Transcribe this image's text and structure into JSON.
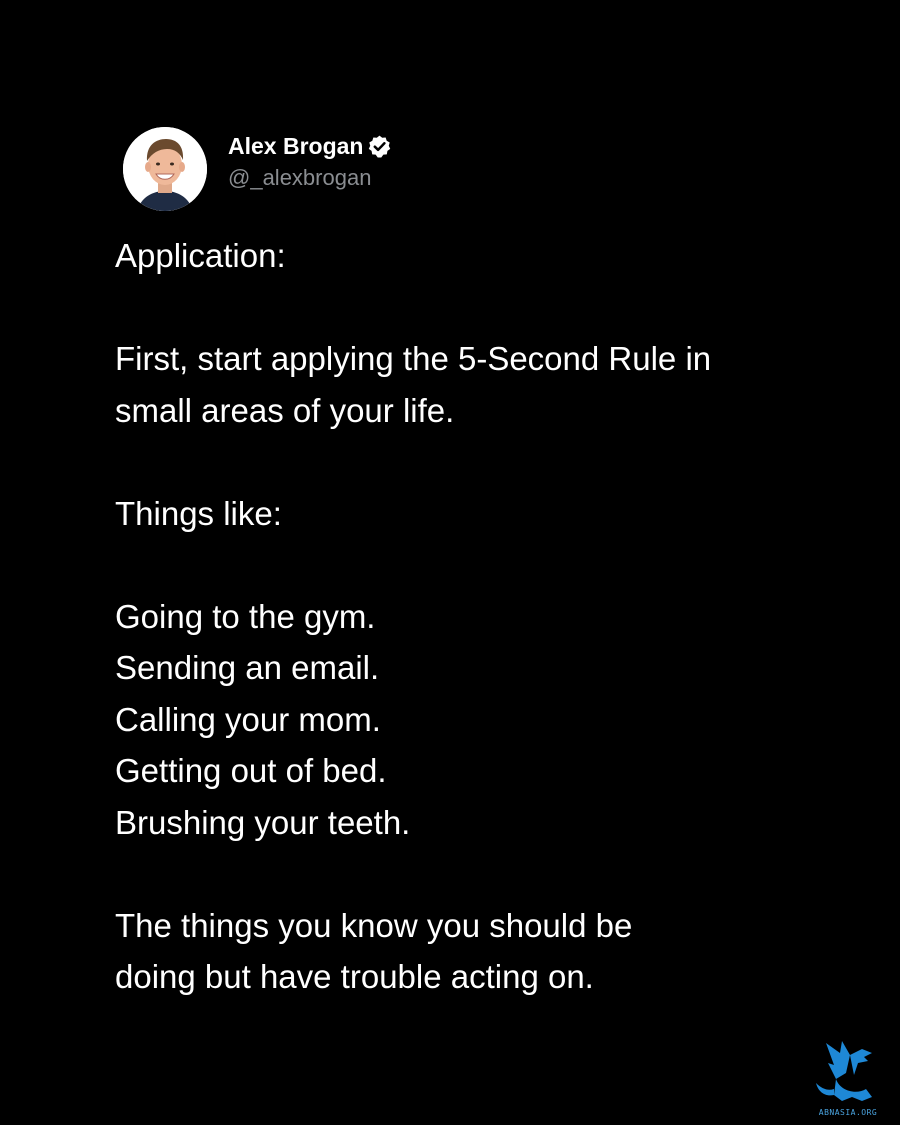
{
  "author": {
    "name": "Alex Brogan",
    "handle": "@_alexbrogan",
    "verified_icon": "verified-badge-icon",
    "avatar_icon": "avatar-photo"
  },
  "tweet": {
    "line1": "Application:",
    "line2": "First, start applying the 5-Second Rule in",
    "line3": "small areas of your life.",
    "line4": "Things like:",
    "line5": "Going to the gym.",
    "line6": "Sending an email.",
    "line7": "Calling your mom.",
    "line8": "Getting out of bed.",
    "line9": "Brushing your teeth.",
    "line10": "The things you know you should be",
    "line11": "doing but have trouble acting on."
  },
  "watermark": {
    "text": "ABNASIA.ORG",
    "icon": "griffin-logo-icon",
    "color": "#1e88d6"
  },
  "colors": {
    "background": "#000000",
    "text": "#ffffff",
    "handle": "#8a8d91"
  }
}
